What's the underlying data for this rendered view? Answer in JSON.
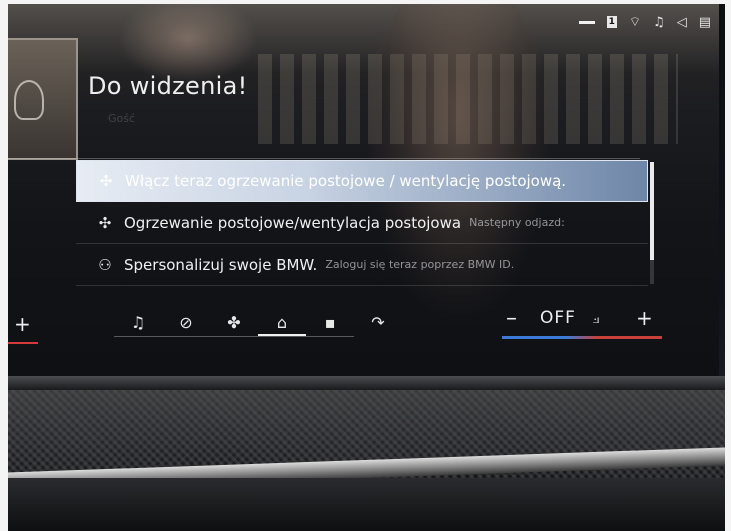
{
  "status_bar": {
    "badge": "1",
    "icons": [
      "wifi-icon",
      "music-icon",
      "speaker-icon",
      "card-icon"
    ]
  },
  "header": {
    "greeting": "Do widzenia!",
    "subtitle": "Gość"
  },
  "menu": {
    "items": [
      {
        "icon": "fan-icon",
        "label": "Włącz teraz ogrzewanie postojowe / wentylację postojową.",
        "sub": "",
        "selected": true
      },
      {
        "icon": "fan-icon",
        "label": "Ogrzewanie postojowe/wentylacja postojowa",
        "sub": "Następny odjazd:",
        "selected": false
      },
      {
        "icon": "person-add-icon",
        "label": "Spersonalizuj swoje BMW.",
        "sub": "Zaloguj się teraz poprzez BMW ID.",
        "selected": false
      }
    ]
  },
  "bottom_bar": {
    "left_plus": "+",
    "nav": [
      {
        "name": "music-icon",
        "glyph": "♫"
      },
      {
        "name": "gauge-icon",
        "glyph": "⊘"
      },
      {
        "name": "fan-icon",
        "glyph": "✤"
      },
      {
        "name": "home-icon",
        "glyph": "⌂",
        "active": true
      },
      {
        "name": "apps-icon",
        "glyph": "▪"
      },
      {
        "name": "phone-icon",
        "glyph": "↷"
      }
    ],
    "climate": {
      "minus": "–",
      "value": "OFF",
      "plus": "+"
    }
  },
  "colors": {
    "selected_highlight": "#c8d3e3",
    "cool_accent": "#3c7ad8",
    "warm_accent": "#c8403a"
  }
}
